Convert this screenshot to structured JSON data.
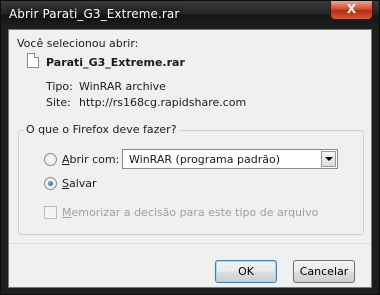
{
  "window": {
    "title": "Abrir Parati_G3_Extreme.rar",
    "close_label": "X"
  },
  "intro": "Você selecionou abrir:",
  "file": {
    "name": "Parati_G3_Extreme.rar",
    "type_label": "Tipo:",
    "type_value": "WinRAR archive",
    "site_label": "Site:",
    "site_value": "http://rs168cg.rapidshare.com"
  },
  "action_group": {
    "legend": "O que o Firefox deve fazer?",
    "open_with": {
      "label_first": "A",
      "label_rest": "brir com:",
      "selected": false,
      "app": "WinRAR (programa padrão)"
    },
    "save": {
      "label_first": "S",
      "label_rest": "alvar",
      "selected": true
    },
    "remember": {
      "label_first": "M",
      "label_rest": "emorizar a decisão para este tipo de arquivo",
      "checked": false,
      "enabled": false
    }
  },
  "buttons": {
    "ok": "OK",
    "cancel": "Cancelar"
  }
}
